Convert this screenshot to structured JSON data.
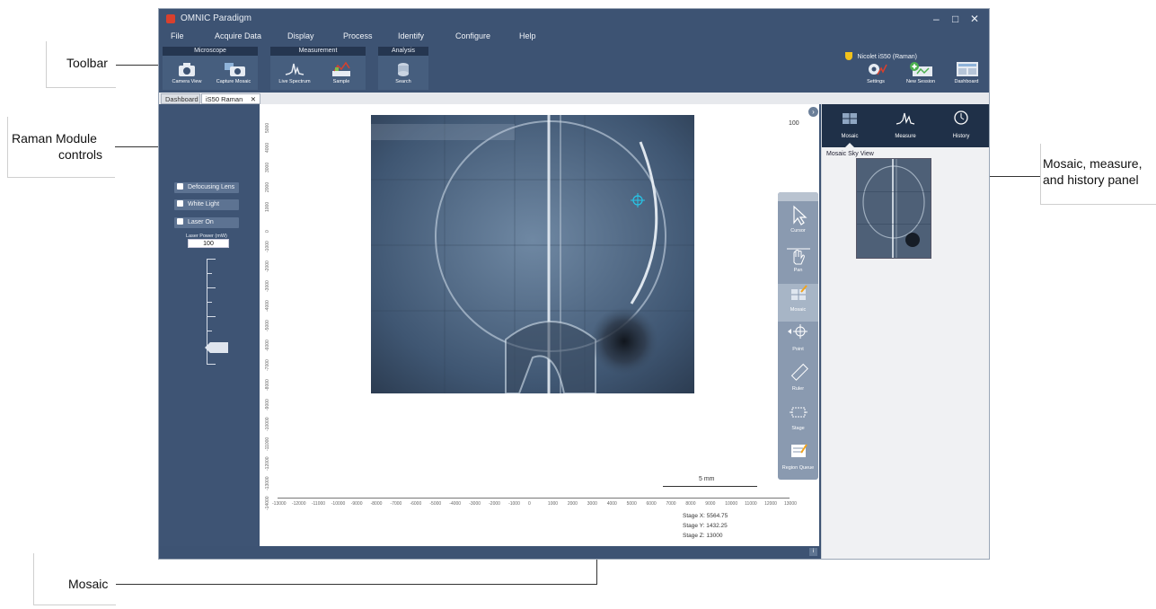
{
  "callouts": {
    "toolbar": "Toolbar",
    "raman_line1": "Raman Module",
    "raman_line2": "controls",
    "mosaic": "Mosaic",
    "panel_line1": "Mosaic, measure,",
    "panel_line2": "and history panel"
  },
  "app": {
    "title": "OMNIC Paradigm",
    "menu": [
      "File",
      "Acquire Data",
      "Display",
      "Process",
      "Identify",
      "Configure",
      "Help"
    ],
    "instrument": "Nicolet iS50 (Raman)"
  },
  "ribbon": {
    "groups": [
      {
        "title": "Microscope",
        "tools": [
          "Camera View",
          "Capture Mosaic"
        ]
      },
      {
        "title": "Measurement",
        "tools": [
          "Live Spectrum",
          "Sample"
        ]
      },
      {
        "title": "Analysis",
        "tools": [
          "Search"
        ]
      }
    ],
    "right_tools": [
      "Settings",
      "New Session",
      "Dashboard"
    ]
  },
  "tabs": [
    "Dashboard",
    "iS50 Raman"
  ],
  "raman_controls": {
    "toggles": [
      "Defocusing Lens",
      "White Light",
      "Laser On"
    ],
    "laser_power_label": "Laser Power (mW)",
    "laser_power_value": "100",
    "laser_power_slider_fraction": 0.15
  },
  "canvas": {
    "zoom": "100",
    "scale_bar": "5 mm",
    "stage_x": "Stage X: 5564.75",
    "stage_y": "Stage Y: 1432.25",
    "stage_z": "Stage Z: 13000",
    "x_ticks": [
      "-13000",
      "-12000",
      "-11000",
      "-10000",
      "-9000",
      "-8000",
      "-7000",
      "-6000",
      "-5000",
      "-4000",
      "-3000",
      "-2000",
      "-1000",
      "0",
      "1000",
      "2000",
      "3000",
      "4000",
      "5000",
      "6000",
      "7000",
      "8000",
      "9000",
      "10000",
      "11000",
      "12000",
      "13000"
    ],
    "y_ticks": [
      "5000",
      "4000",
      "3000",
      "2000",
      "1000",
      "0",
      "-1000",
      "-2000",
      "-3000",
      "-4000",
      "-5000",
      "-6000",
      "-7000",
      "-8000",
      "-9000",
      "-10000",
      "-11000",
      "-12000",
      "-13000",
      "-14000"
    ]
  },
  "tools": [
    "Cursor",
    "Pan",
    "Mosaic",
    "Point",
    "Ruler",
    "Stage",
    "Region Queue"
  ],
  "right_panel": {
    "tabs": [
      "Mosaic",
      "Measure",
      "History"
    ],
    "sky_view_label": "Mosaic Sky View"
  },
  "colors": {
    "app_bg": "#3d5373",
    "panel_dark": "#1f3048",
    "accent_red": "#d9402d"
  }
}
